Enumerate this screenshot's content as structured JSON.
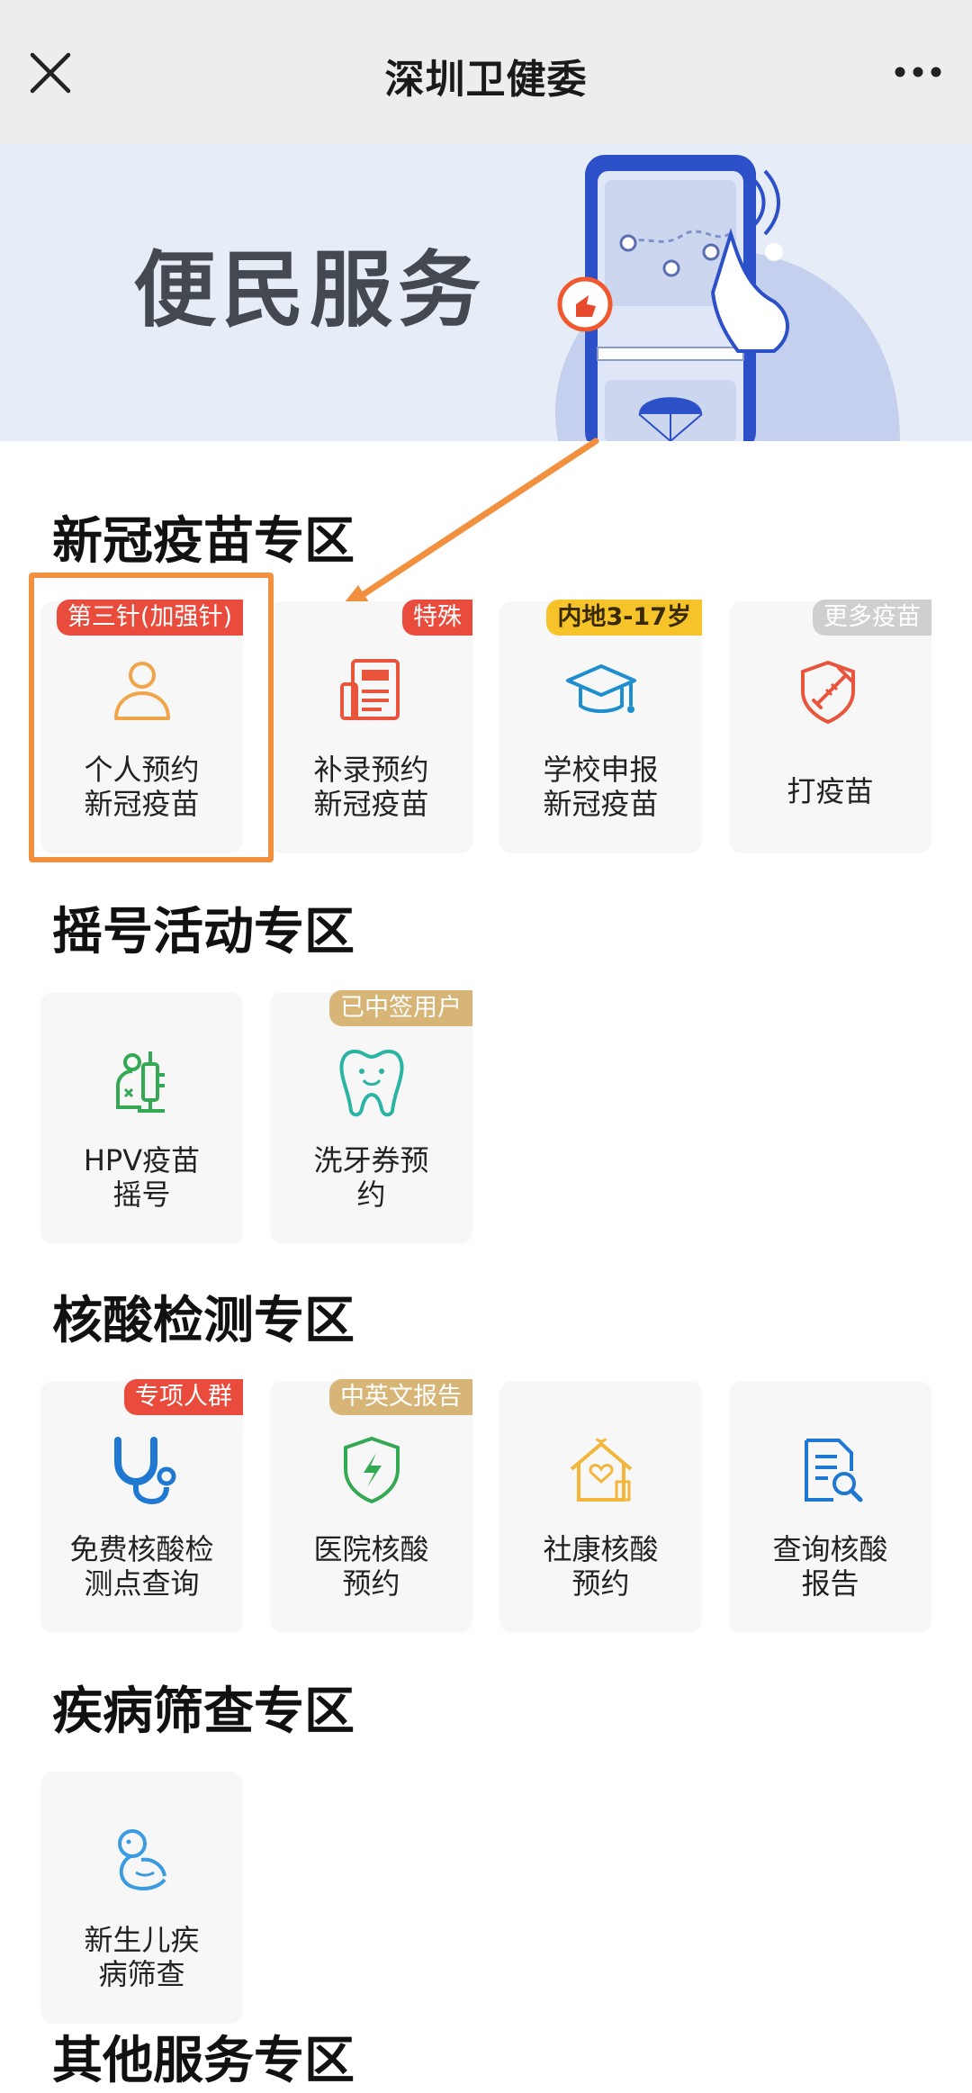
{
  "nav": {
    "title": "深圳卫健委"
  },
  "banner": {
    "title": "便民服务"
  },
  "sections": [
    {
      "title": "新冠疫苗专区",
      "cards": [
        {
          "icon": "person-icon",
          "badge": "第三针(加强针)",
          "line1": "个人预约",
          "line2": "新冠疫苗"
        },
        {
          "icon": "form-document-icon",
          "badge": "特殊",
          "line1": "补录预约",
          "line2": "新冠疫苗"
        },
        {
          "icon": "graduation-cap-icon",
          "badge": "内地3-17岁",
          "line1": "学校申报",
          "line2": "新冠疫苗"
        },
        {
          "icon": "vaccine-shield-icon",
          "badge": "更多疫苗",
          "line1": "打疫苗"
        }
      ]
    },
    {
      "title": "摇号活动专区",
      "cards": [
        {
          "icon": "hpv-vaccine-icon",
          "line1": "HPV疫苗",
          "line2": "摇号"
        },
        {
          "icon": "tooth-icon",
          "badge": "已中签用户",
          "line1": "洗牙券预",
          "line2": "约"
        }
      ]
    },
    {
      "title": "核酸检测专区",
      "cards": [
        {
          "icon": "stethoscope-icon",
          "badge": "专项人群",
          "line1": "免费核酸检",
          "line2": "测点查询"
        },
        {
          "icon": "shield-bolt-icon",
          "badge": "中英文报告",
          "line1": "医院核酸",
          "line2": "预约"
        },
        {
          "icon": "community-house-icon",
          "line1": "社康核酸",
          "line2": "预约"
        },
        {
          "icon": "report-search-icon",
          "line1": "查询核酸",
          "line2": "报告"
        }
      ]
    },
    {
      "title": "疾病筛查专区",
      "cards": [
        {
          "icon": "newborn-icon",
          "line1": "新生儿疾",
          "line2": "病筛查"
        }
      ]
    },
    {
      "title": "其他服务专区"
    }
  ]
}
